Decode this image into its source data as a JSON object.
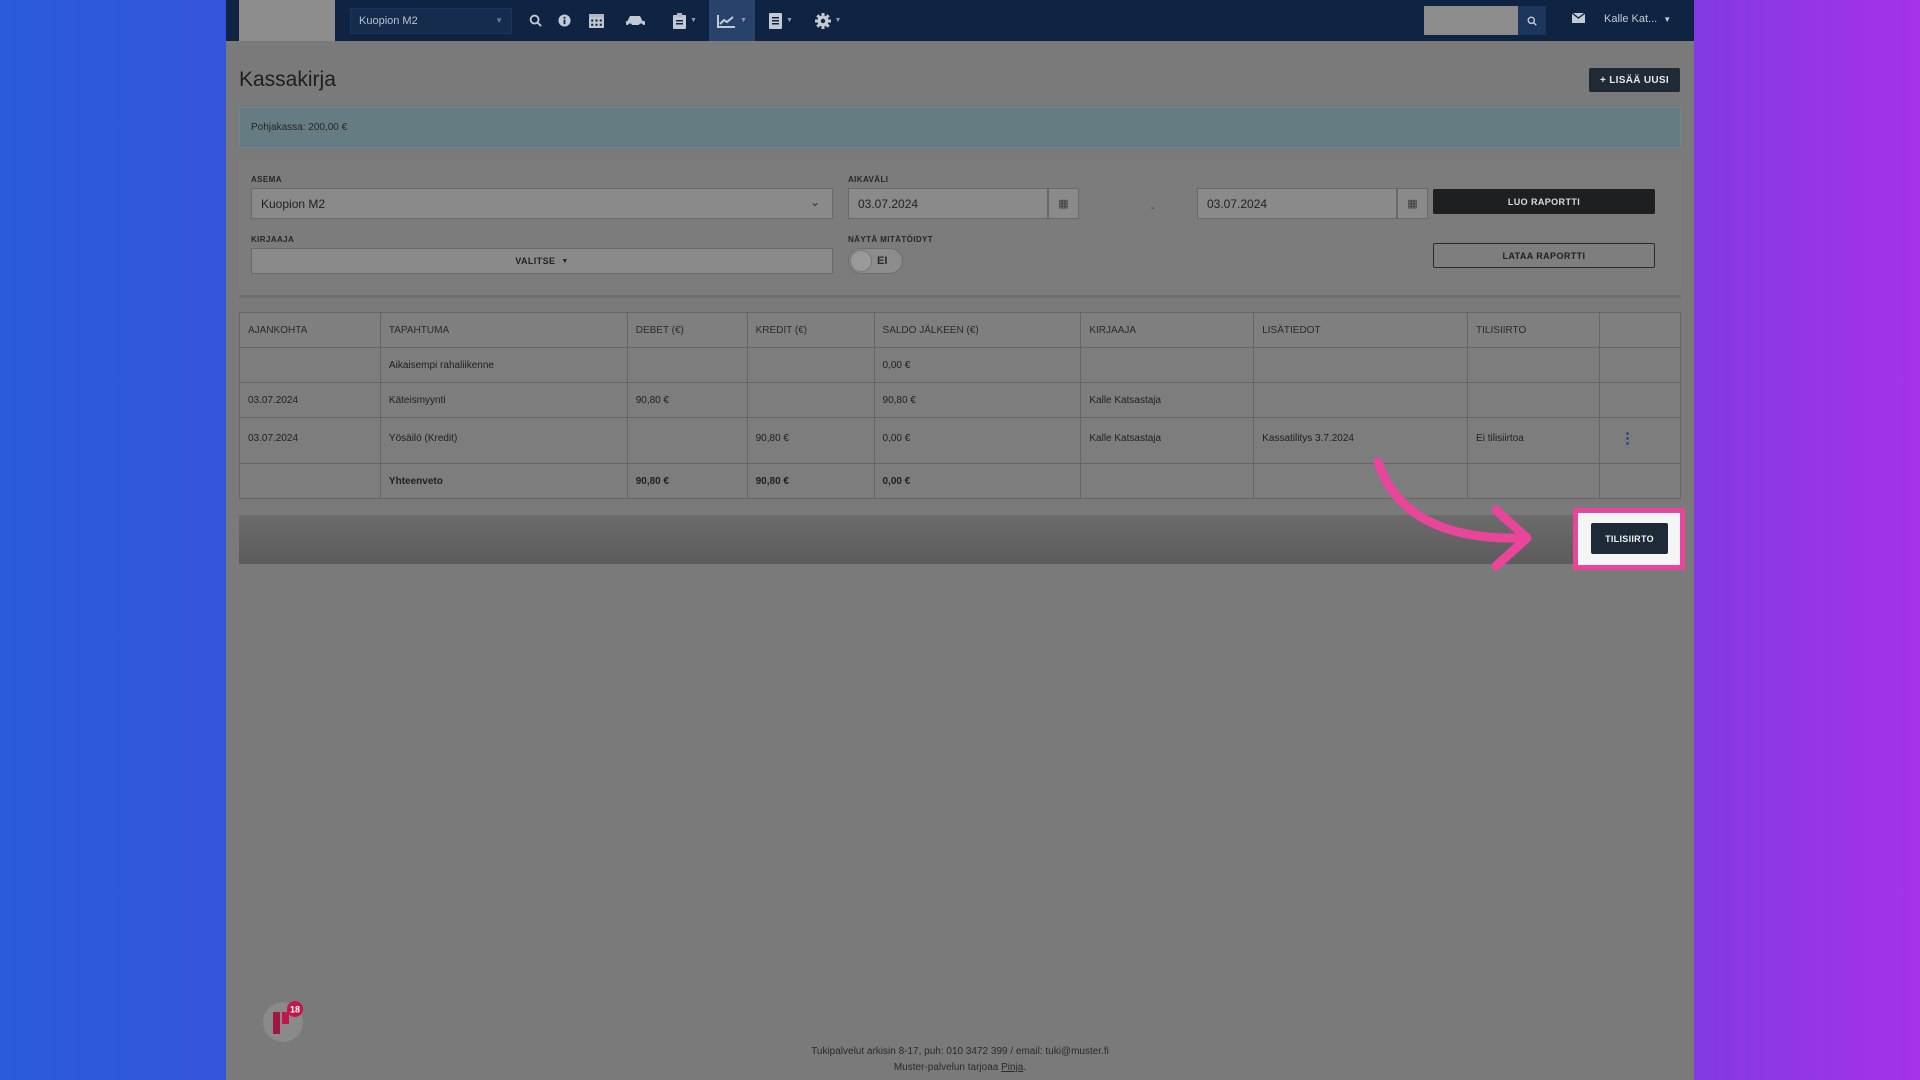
{
  "nav": {
    "station": "Kuopion M2",
    "user": "Kalle Kat...",
    "icons": [
      "search-icon",
      "info-icon",
      "calendar-icon",
      "car-icon",
      "clipboard-icon",
      "chart-icon",
      "document-icon",
      "gear-icon"
    ]
  },
  "page": {
    "title": "Kassakirja",
    "add_new": "+ LISÄÄ UUSI",
    "alert": "Pohjakassa: 200,00 €"
  },
  "filters": {
    "asema_label": "ASEMA",
    "asema_value": "Kuopion M2",
    "aikavali_label": "AIKAVÄLI",
    "date_from": "03.07.2024",
    "date_to": "03.07.2024",
    "date_sep": "-",
    "kirjaaja_label": "KIRJAAJA",
    "kirjaaja_value": "VALITSE",
    "nayta_label": "NÄYTÄ MITÄTÖIDYT",
    "toggle_text": "EI",
    "luo_raportti": "LUO RAPORTTI",
    "lataa_raportti": "LATAA RAPORTTI"
  },
  "table": {
    "headers": [
      "AJANKOHTA",
      "TAPAHTUMA",
      "DEBET (€)",
      "KREDIT (€)",
      "SALDO JÄLKEEN (€)",
      "KIRJAAJA",
      "LISÄTIEDOT",
      "TILISIIRTO",
      ""
    ],
    "rows": [
      [
        "",
        "Aikaisempi rahaliikenne",
        "",
        "",
        "0,00 €",
        "",
        "",
        "",
        ""
      ],
      [
        "03.07.2024",
        "Käteismyynti",
        "90,80 €",
        "",
        "90,80 €",
        "Kalle Katsastaja",
        "",
        "",
        ""
      ],
      [
        "03.07.2024",
        "Yösäilö (Kredit)",
        "",
        "90,80 €",
        "0,00 €",
        "Kalle Katsastaja",
        "Kassatilitys 3.7.2024",
        "Ei tilisiirtoa",
        ""
      ],
      [
        "",
        "Yhteenveto",
        "90,80 €",
        "90,80 €",
        "0,00 €",
        "",
        "",
        "",
        ""
      ]
    ]
  },
  "actions": {
    "tilisiirto": "TILISIIRTO"
  },
  "footer": {
    "support": "Tukipalvelut arkisin 8-17, puh: 010 3472 399 / email: tuki@muster.fi",
    "provider_prefix": "Muster-palvelun tarjoaa ",
    "provider_link": "Pinja",
    "provider_suffix": ".",
    "badge_count": "18"
  },
  "colors": {
    "highlight": "#e8459b",
    "nav_bg": "#0f2442"
  }
}
